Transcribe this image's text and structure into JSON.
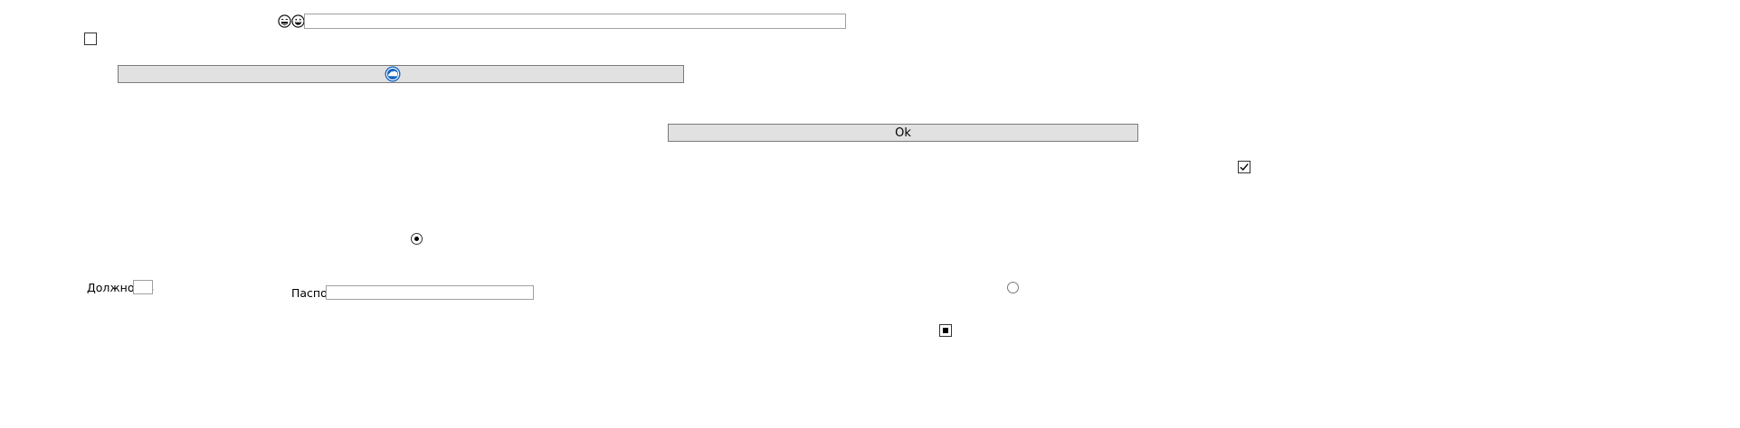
{
  "top_bar": {
    "emoji_left_icon": "emoji-laughing-icon",
    "emoji_right_icon": "emoji-grinning-icon",
    "search_value": ""
  },
  "image_button": {
    "icon": "blue-globe-cloud-icon",
    "accent_color": "#1565c0"
  },
  "ok_button": {
    "label": "Ok"
  },
  "form": {
    "position_label": "Должность",
    "position_value": "",
    "passport_label": "Паспорт",
    "passport_value": ""
  },
  "controls": {
    "top_checkbox_checked": false,
    "right_checkbox_checked": true,
    "center_radio_selected": true,
    "right_radio_selected": false,
    "bottom_checkbox_state": "indeterminate"
  }
}
